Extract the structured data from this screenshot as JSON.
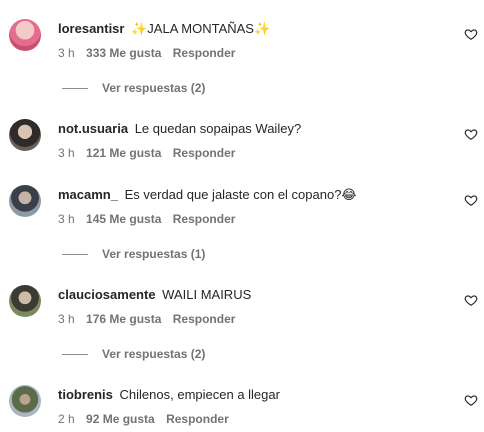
{
  "comments": [
    {
      "user": "loresantisr",
      "text": "✨JALA MONTAÑAS✨",
      "time": "3 h",
      "likes": "333 Me gusta",
      "reply": "Responder",
      "replies": "Ver respuestas (2)"
    },
    {
      "user": "not.usuaria",
      "text": "Le quedan sopaipas Wailey?",
      "time": "3 h",
      "likes": "121 Me gusta",
      "reply": "Responder"
    },
    {
      "user": "macamn_",
      "text": "Es verdad que jalaste con el copano?😂",
      "time": "3 h",
      "likes": "145 Me gusta",
      "reply": "Responder",
      "replies": "Ver respuestas (1)"
    },
    {
      "user": "clauciosamente",
      "text": "WAILI MAIRUS",
      "time": "3 h",
      "likes": "176 Me gusta",
      "reply": "Responder",
      "replies": "Ver respuestas (2)"
    },
    {
      "user": "tiobrenis",
      "text": "Chilenos, empiecen a llegar",
      "time": "2 h",
      "likes": "92 Me gusta",
      "reply": "Responder"
    }
  ],
  "icons": {
    "like": "heart-outline-icon"
  }
}
